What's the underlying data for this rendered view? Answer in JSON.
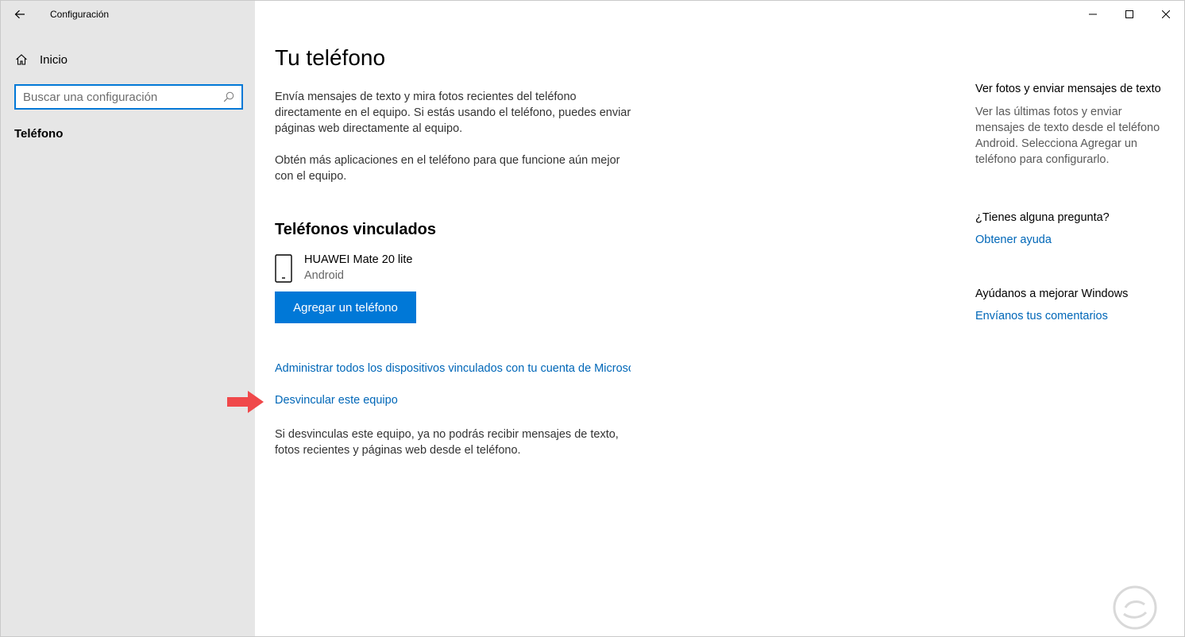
{
  "window": {
    "title": "Configuración"
  },
  "sidebar": {
    "home_label": "Inicio",
    "search_placeholder": "Buscar una configuración",
    "current_item": "Teléfono"
  },
  "main": {
    "page_title": "Tu teléfono",
    "intro_text": "Envía mensajes de texto y mira fotos recientes del teléfono directamente en el equipo. Si estás usando el teléfono, puedes enviar páginas web directamente al equipo.",
    "more_apps_text": "Obtén más aplicaciones en el teléfono para que funcione aún mejor con el equipo.",
    "linked_phones_title": "Teléfonos vinculados",
    "device": {
      "name": "HUAWEI Mate 20 lite",
      "os": "Android"
    },
    "add_phone_button": "Agregar un teléfono",
    "manage_devices_link": "Administrar todos los dispositivos vinculados con tu cuenta de Microsoft",
    "unlink_link": "Desvincular este equipo",
    "unlink_note": "Si desvinculas este equipo, ya no podrás recibir mensajes de texto, fotos recientes y páginas web desde el teléfono."
  },
  "aside": {
    "photos_title": "Ver fotos y enviar mensajes de texto",
    "photos_text": "Ver las últimas fotos y enviar mensajes de texto desde el teléfono Android. Selecciona Agregar un teléfono para configurarlo.",
    "question_title": "¿Tienes alguna pregunta?",
    "help_link": "Obtener ayuda",
    "improve_title": "Ayúdanos a mejorar Windows",
    "feedback_link": "Envíanos tus comentarios"
  },
  "colors": {
    "accent": "#0078d7",
    "link": "#0067b8",
    "sidebar_bg": "#e6e6e6",
    "arrow": "#f0484a"
  },
  "icons": [
    "back-arrow-icon",
    "home-icon",
    "search-icon",
    "minimize-icon",
    "maximize-icon",
    "close-icon",
    "phone-icon",
    "pointer-arrow-icon",
    "watermark-logo"
  ]
}
